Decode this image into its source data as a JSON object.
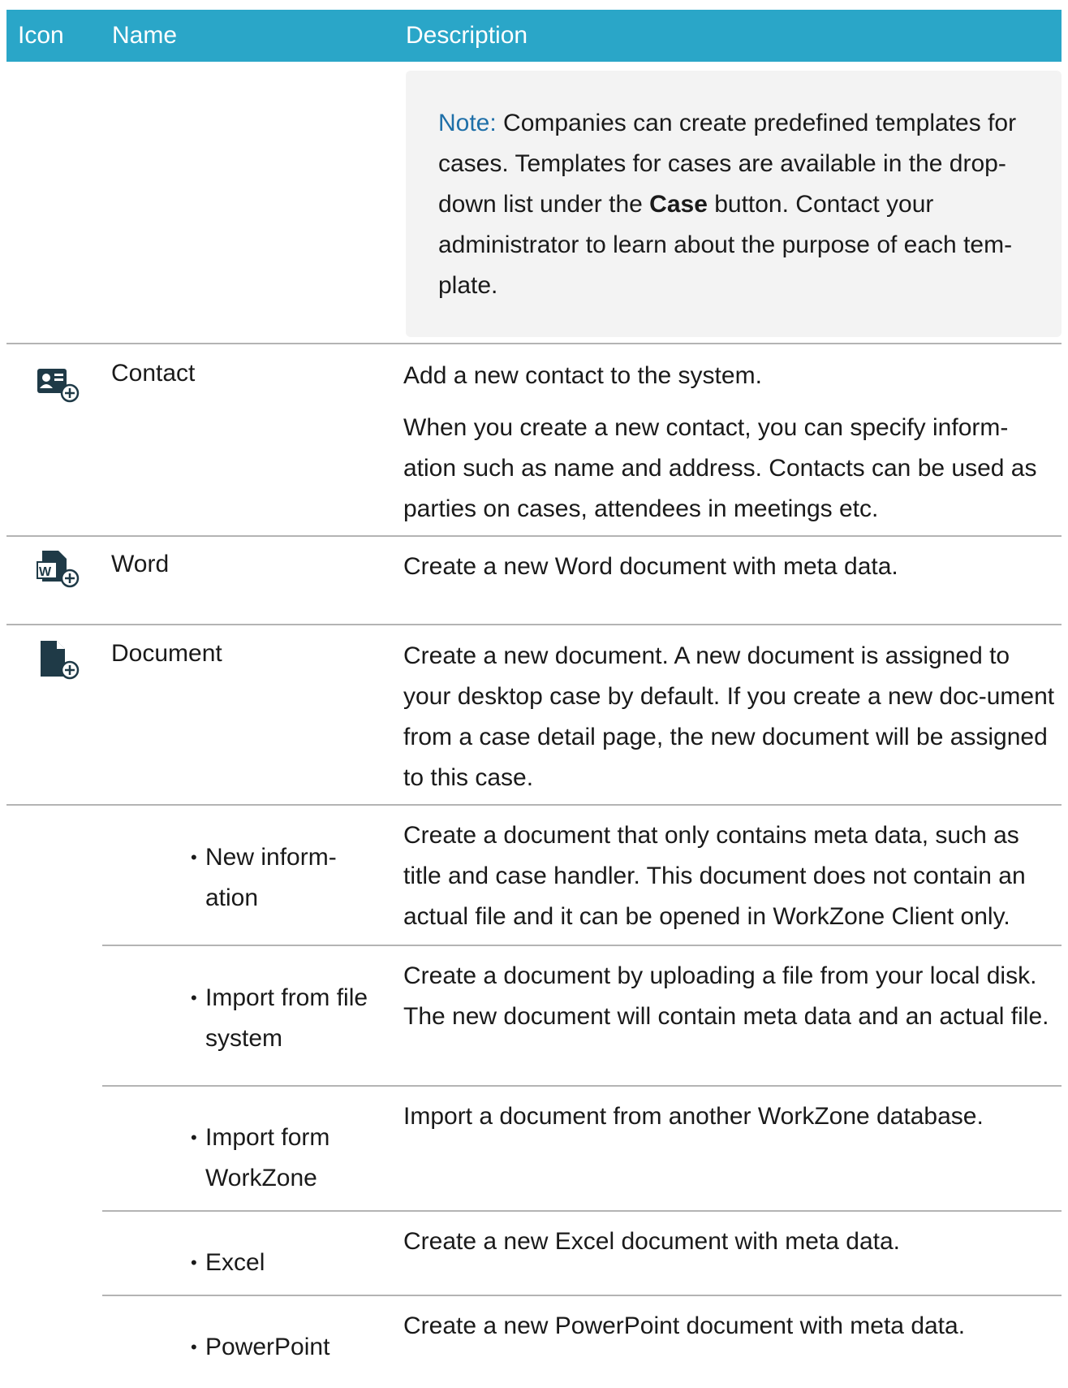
{
  "header": {
    "col_icon": "Icon",
    "col_name": "Name",
    "col_description": "Description"
  },
  "note": {
    "label": "Note:",
    "text_before": " Companies can create predefined templates for cases. Templates for cases are available in the drop-down list under the ",
    "strong": "Case",
    "text_after": " button. Contact your administrator to learn about the purpose of each tem-plate."
  },
  "rows": [
    {
      "icon": "contact-add-icon",
      "name": "Contact",
      "desc1": "Add a new contact to the system.",
      "desc2": "When you create a new contact, you can specify inform-ation such as name and address. Contacts can be used as parties on cases, attendees in meetings etc."
    },
    {
      "icon": "word-add-icon",
      "name": "Word",
      "desc1": "Create a new Word document with meta data."
    },
    {
      "icon": "document-add-icon",
      "name": "Document",
      "desc1": "Create a new document. A new document is assigned to your desktop case by default. If you create a new doc-ument from a case detail page, the new document will be assigned to this case."
    }
  ],
  "subrows": [
    {
      "name": "New inform-ation",
      "desc": "Create a document that only contains meta data, such as title and case handler. This document does not contain an actual file and it can be opened in WorkZone Client only."
    },
    {
      "name": "Import from file system",
      "desc": "Create a document by uploading a file from your local disk. The new document will contain meta data and an actual file."
    },
    {
      "name": "Import form WorkZone",
      "desc": "Import a document from another WorkZone database."
    },
    {
      "name": "Excel",
      "desc": "Create a new Excel document with meta data."
    },
    {
      "name": "PowerPoint",
      "desc": "Create a new PowerPoint document with meta data."
    }
  ]
}
